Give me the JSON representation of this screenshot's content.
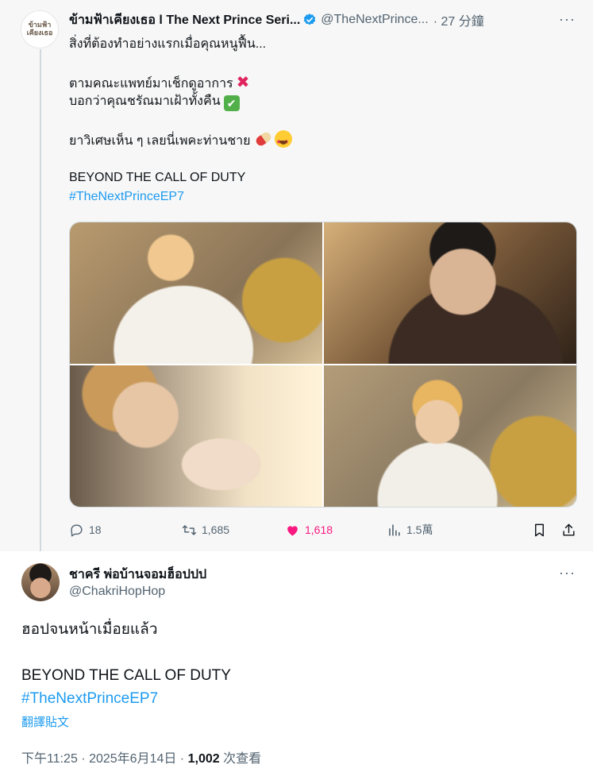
{
  "parent_tweet": {
    "avatar_label": "ข้ามฟ้า เคียงเธอ",
    "display_name": "ข้ามฟ้าเคียงเธอ l The Next Prince Seri...",
    "handle": "@TheNextPrince...",
    "time": "· 27 分鐘",
    "more_label": "···",
    "lines": [
      "สิ่งที่ต้องทำอย่างแรกเมื่อคุณหนูฟื้น...",
      "ตามคณะแพทย์มาเช็กดูอาการ",
      "บอกว่าคุณชรัณมาเฝ้าทั้งคืน",
      "ยาวิเศษเห็น ๆ เลยนี่เพคะท่านชาย",
      "BEYOND THE CALL OF DUTY",
      "#TheNextPrinceEP7"
    ],
    "emoji": {
      "cross": "✖",
      "check": "✔"
    },
    "actions": {
      "reply_count": "18",
      "retweet_count": "1,685",
      "like_count": "1,618",
      "view_count": "1.5萬"
    }
  },
  "reply_tweet": {
    "display_name": "ชาครี พ่อบ้านจอมฮ็อปปป",
    "handle": "@ChakriHopHop",
    "more_label": "···",
    "lines": [
      "ฮอปจนหน้าเมื่อยแล้ว",
      "BEYOND THE CALL OF DUTY",
      "#TheNextPrinceEP7"
    ],
    "translate_label": "翻譯貼文",
    "meta": {
      "time": "下午11:25 · 2025年6月14日 · ",
      "views_number": "1,002",
      "views_label": " 次查看"
    }
  },
  "colors": {
    "accent": "#1d9bf0",
    "like": "#f91880",
    "muted": "#536471",
    "text": "#0f1419"
  }
}
